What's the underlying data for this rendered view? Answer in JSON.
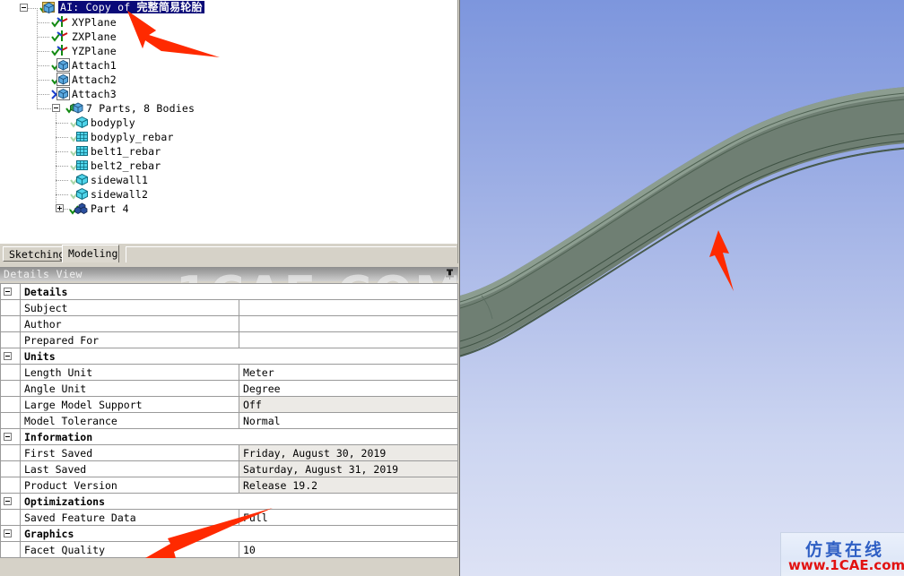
{
  "tree": {
    "root": {
      "label_prefix": "AI: Copy of ",
      "label_cjk": "完整简易轮胎",
      "selected": true
    },
    "planes": [
      {
        "label": "XYPlane",
        "state": "ok"
      },
      {
        "label": "ZXPlane",
        "state": "ok"
      },
      {
        "label": "YZPlane",
        "state": "ok"
      }
    ],
    "attaches": [
      {
        "label": "Attach1",
        "state": "ok"
      },
      {
        "label": "Attach2",
        "state": "ok"
      },
      {
        "label": "Attach3",
        "state": "suppressed"
      }
    ],
    "parts_group": {
      "label": "7 Parts, 8 Bodies",
      "state": "ok"
    },
    "bodies": [
      {
        "label": "bodyply",
        "type": "solid"
      },
      {
        "label": "bodyply_rebar",
        "type": "surface"
      },
      {
        "label": "belt1_rebar",
        "type": "surface"
      },
      {
        "label": "belt2_rebar",
        "type": "surface"
      },
      {
        "label": "sidewall1",
        "type": "solid"
      },
      {
        "label": "sidewall2",
        "type": "solid"
      }
    ],
    "part4": {
      "label": "Part 4",
      "state": "ok"
    }
  },
  "tabs": [
    {
      "label": "Sketching",
      "active": false
    },
    {
      "label": "Modeling",
      "active": true
    }
  ],
  "details_view": {
    "title": "Details View",
    "pin_icon": "pushpin-icon",
    "groups": [
      {
        "name": "Details",
        "rows": [
          {
            "key": "Subject",
            "value": "",
            "dim": false
          },
          {
            "key": "Author",
            "value": "",
            "dim": false
          },
          {
            "key": "Prepared For",
            "value": "",
            "dim": false
          }
        ]
      },
      {
        "name": "Units",
        "rows": [
          {
            "key": "Length Unit",
            "value": "Meter",
            "dim": false
          },
          {
            "key": "Angle Unit",
            "value": "Degree",
            "dim": false
          },
          {
            "key": "Large Model Support",
            "value": "Off",
            "dim": true
          },
          {
            "key": "Model Tolerance",
            "value": "Normal",
            "dim": false
          }
        ]
      },
      {
        "name": "Information",
        "rows": [
          {
            "key": "First Saved",
            "value": "Friday, August 30, 2019",
            "dim": true
          },
          {
            "key": "Last Saved",
            "value": "Saturday, August 31, 2019",
            "dim": true
          },
          {
            "key": "Product Version",
            "value": "Release 19.2",
            "dim": true
          }
        ]
      },
      {
        "name": "Optimizations",
        "rows": [
          {
            "key": "Saved Feature Data",
            "value": "Full",
            "dim": false
          }
        ]
      },
      {
        "name": "Graphics",
        "rows": [
          {
            "key": "Facet Quality",
            "value": "10",
            "dim": false
          }
        ]
      }
    ]
  },
  "watermarks": {
    "center_text": "1CAE.COM",
    "logo_cn": "仿真在线",
    "logo_en": "www.1CAE.com"
  },
  "annotations": [
    {
      "name": "arrow-to-tree-root",
      "points_to": "AI: Copy of 完整简易轮胎"
    },
    {
      "name": "arrow-to-tire-layers",
      "points_to": "rebar layers in model"
    },
    {
      "name": "arrow-to-facet-quality",
      "points_to": "Facet Quality"
    }
  ],
  "colors": {
    "selection": "#0a0a78",
    "arrow": "#ff2a00",
    "viewport_top": "#7d96dd",
    "viewport_bottom": "#dde2f5",
    "model_body": "#6f7f73",
    "panel_bg": "#d6d2c8"
  },
  "viewport": {
    "model": "tire cross-section with rebar layers",
    "background": "blue gradient"
  }
}
